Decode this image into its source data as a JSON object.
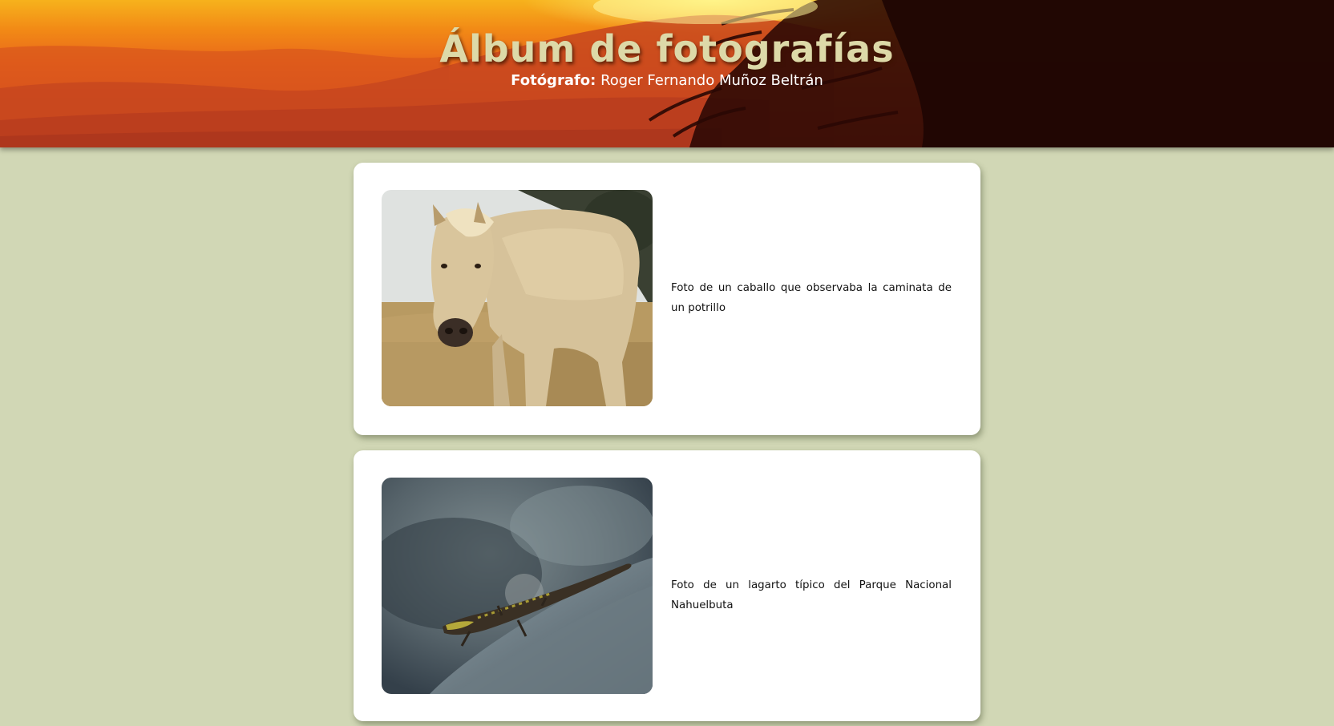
{
  "header": {
    "title": "Álbum de fotografías",
    "subtitle_label": "Fotógrafo:",
    "subtitle_name": " Roger Fernando Muñoz Beltrán"
  },
  "colors": {
    "page_background": "#d1d7b5",
    "card_background": "#ffffff",
    "title_color": "#ddd9a8",
    "header_orange": "#e8631a"
  },
  "photos": [
    {
      "subject": "horse-photo",
      "caption": "Foto de un caballo que observaba la caminata de un potrillo"
    },
    {
      "subject": "lizard-photo",
      "caption": "Foto de un lagarto típico del Parque Nacional Nahuelbuta"
    }
  ]
}
